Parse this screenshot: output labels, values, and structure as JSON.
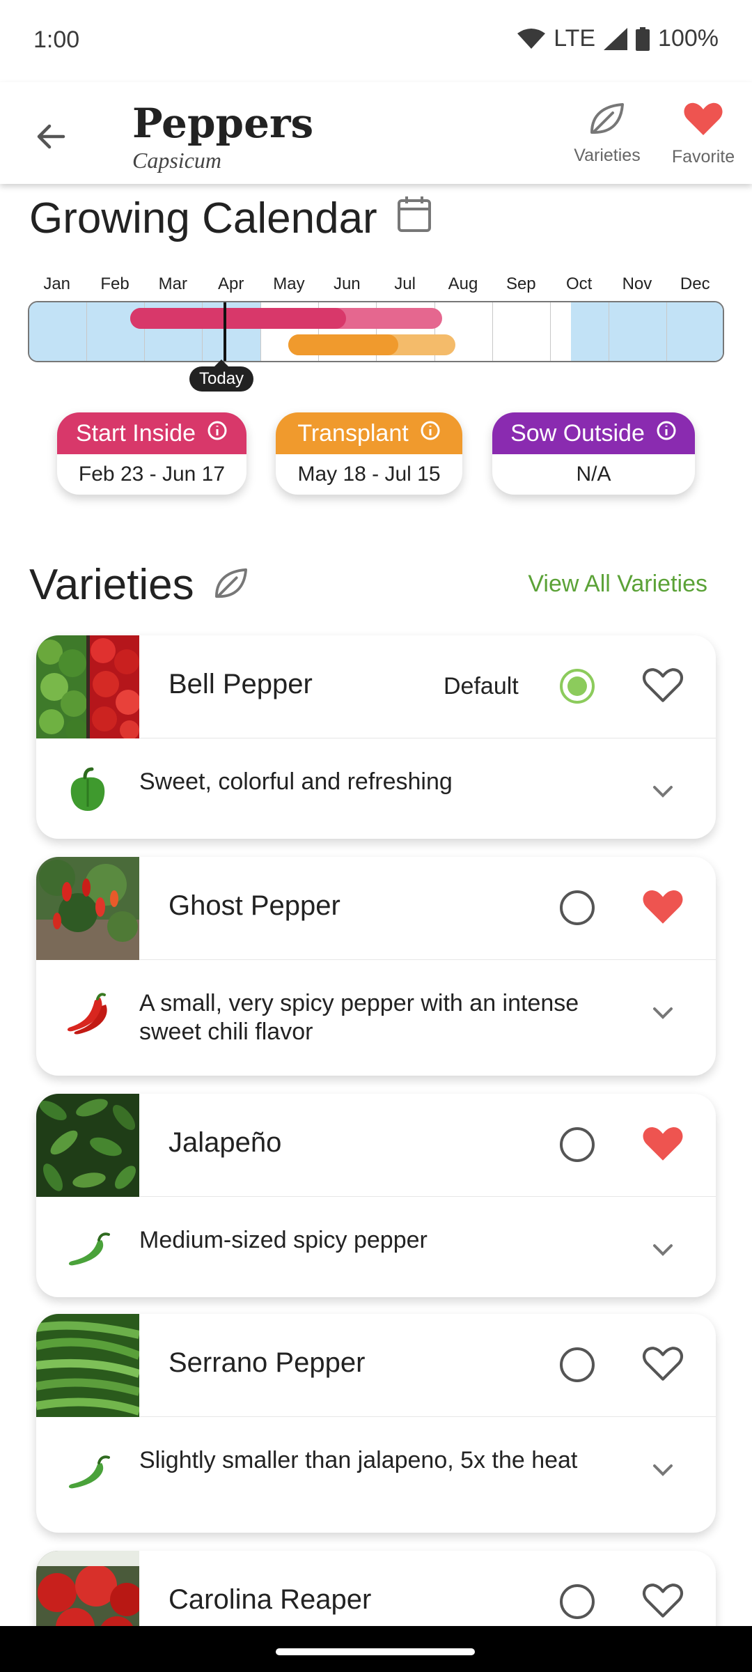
{
  "status": {
    "time": "1:00",
    "network": "LTE",
    "battery": "100%"
  },
  "appbar": {
    "title": "Peppers",
    "subtitle": "Capsicum",
    "varieties_label": "Varieties",
    "favorite_label": "Favorite"
  },
  "calendar": {
    "title": "Growing Calendar",
    "months": [
      "Jan",
      "Feb",
      "Mar",
      "Apr",
      "May",
      "Jun",
      "Jul",
      "Aug",
      "Sep",
      "Oct",
      "Nov",
      "Dec"
    ],
    "today_label": "Today",
    "chips": [
      {
        "label": "Start Inside",
        "value": "Feb 23 - Jun 17",
        "color": "#d8386a"
      },
      {
        "label": "Transplant",
        "value": "May 18 - Jul 15",
        "color": "#f09a2d"
      },
      {
        "label": "Sow Outside",
        "value": "N/A",
        "color": "#8a2bb0"
      }
    ]
  },
  "varieties": {
    "title": "Varieties",
    "view_all": "View All Varieties",
    "default_label": "Default",
    "items": [
      {
        "name": "Bell Pepper",
        "desc": "Sweet, colorful and refreshing",
        "is_default": true,
        "favorite": false
      },
      {
        "name": "Ghost Pepper",
        "desc": "A small, very spicy pepper with an intense sweet chili flavor",
        "is_default": false,
        "favorite": true
      },
      {
        "name": "Jalapeño",
        "desc": "Medium-sized spicy pepper",
        "is_default": false,
        "favorite": true
      },
      {
        "name": "Serrano Pepper",
        "desc": "Slightly smaller than jalapeno, 5x the heat",
        "is_default": false,
        "favorite": false
      },
      {
        "name": "Carolina Reaper",
        "desc": "",
        "is_default": false,
        "favorite": false
      }
    ]
  },
  "colors": {
    "accent_green": "#5ba237",
    "heart_red": "#ee5450",
    "calendar_blue": "#c2e2f6"
  }
}
